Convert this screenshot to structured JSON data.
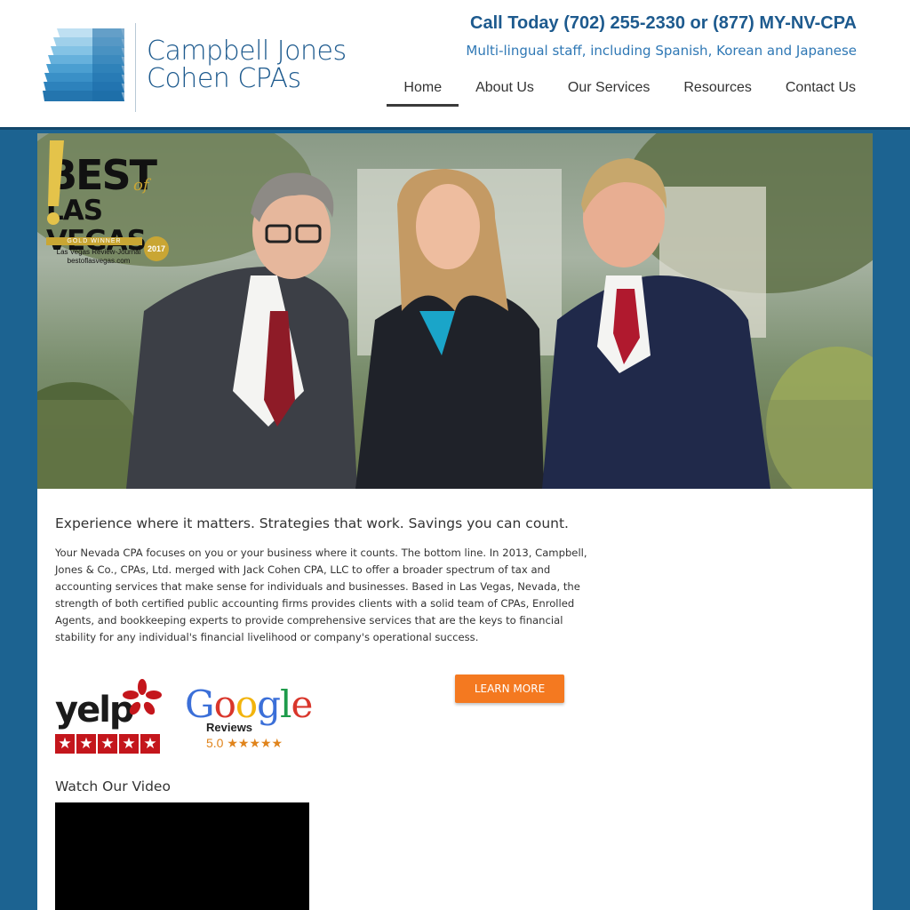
{
  "header": {
    "logo_line1": "Campbell Jones",
    "logo_line2": "Cohen CPAs",
    "phone": "Call Today (702) 255-2330 or (877) MY-NV-CPA",
    "tagline": "Multi-lingual staff, including Spanish, Korean and Japanese"
  },
  "nav": {
    "items": [
      {
        "label": "Home"
      },
      {
        "label": "About Us"
      },
      {
        "label": "Our Services"
      },
      {
        "label": "Resources"
      },
      {
        "label": "Contact Us"
      }
    ]
  },
  "badge": {
    "best": "BEST",
    "of": "of",
    "las_vegas": "LAS VEGAS",
    "gold_winner": "GOLD WINNER",
    "line1": "Las Vegas Review-Journal",
    "line2": "bestoflasvegas.com",
    "year": "2017"
  },
  "main": {
    "headline": "Experience where it matters.  Strategies that work.  Savings you can count.",
    "body": "Your Nevada CPA focuses on you or your business where it counts. The bottom line. In 2013, Campbell, Jones & Co., CPAs, Ltd. merged with Jack Cohen CPA, LLC to offer a broader spectrum of tax and accounting services that make sense for individuals and businesses. Based in Las Vegas, Nevada, the strength of both certified public accounting firms provides clients with a solid team of CPAs, Enrolled Agents, and bookkeeping experts to provide comprehensive services that are the keys to financial stability for any individual's financial livelihood or company's operational success.",
    "learn_more": "LEARN MORE",
    "video_title": "Watch Our Video"
  },
  "reviews": {
    "yelp_word": "yelp",
    "google_reviews": "Reviews",
    "google_rating": "5.0 ★★★★★"
  },
  "colors": {
    "page_bg": "#1c6391",
    "brand_blue": "#1d5a8e",
    "button_orange": "#f47920"
  }
}
